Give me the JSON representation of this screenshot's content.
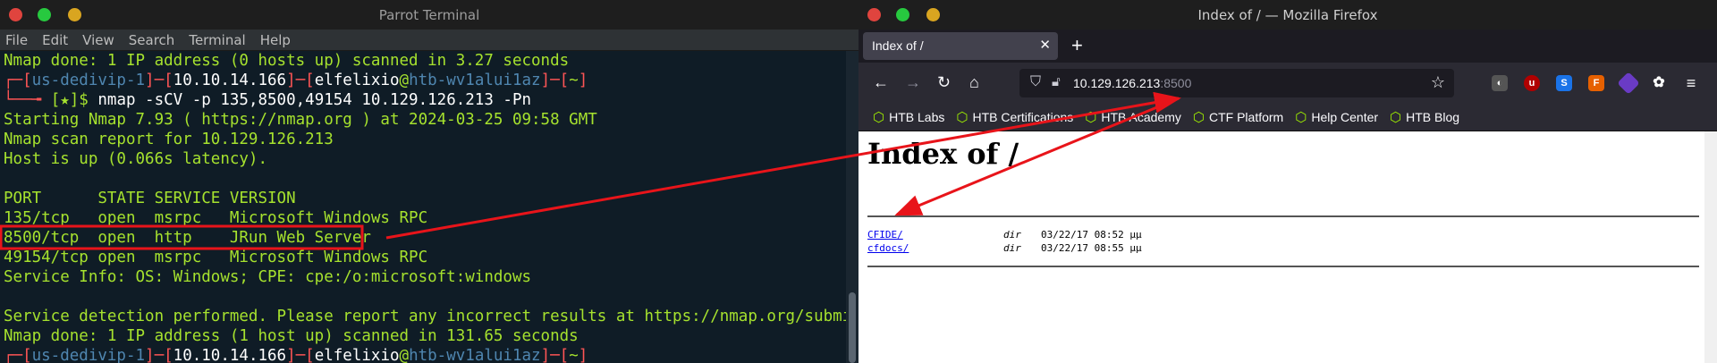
{
  "terminal": {
    "title": "Parrot Terminal",
    "menu": [
      "File",
      "Edit",
      "View",
      "Search",
      "Terminal",
      "Help"
    ],
    "lines": [
      {
        "parts": [
          {
            "t": "Nmap done: 1 IP address (0 hosts up) scanned in 3.27 seconds",
            "c": "c-g"
          }
        ]
      },
      {
        "parts": [
          {
            "t": "┌─[",
            "c": "c-red"
          },
          {
            "t": "us-dedivip-1",
            "c": "c-dim"
          },
          {
            "t": "]─[",
            "c": "c-red"
          },
          {
            "t": "10.10.14.166",
            "c": "c-white"
          },
          {
            "t": "]─[",
            "c": "c-red"
          },
          {
            "t": "elfelixio",
            "c": "c-white"
          },
          {
            "t": "@",
            "c": "c-g"
          },
          {
            "t": "htb-wv1alui1az",
            "c": "c-dim"
          },
          {
            "t": "]─[",
            "c": "c-red"
          },
          {
            "t": "~",
            "c": "c-g"
          },
          {
            "t": "]",
            "c": "c-red"
          }
        ]
      },
      {
        "parts": [
          {
            "t": "└──╼ ",
            "c": "c-red"
          },
          {
            "t": "[★]$ ",
            "c": "c-g"
          },
          {
            "t": "nmap -sCV -p 135,8500,49154 10.129.126.213 -Pn",
            "c": "c-white"
          }
        ]
      },
      {
        "parts": [
          {
            "t": "Starting Nmap 7.93 ( https://nmap.org ) at 2024-03-25 09:58 GMT",
            "c": "c-g"
          }
        ]
      },
      {
        "parts": [
          {
            "t": "Nmap scan report for 10.129.126.213",
            "c": "c-g"
          }
        ]
      },
      {
        "parts": [
          {
            "t": "Host is up (0.066s latency).",
            "c": "c-g"
          }
        ]
      },
      {
        "parts": [
          {
            "t": "",
            "c": "c-g"
          }
        ]
      },
      {
        "parts": [
          {
            "t": "PORT      STATE SERVICE VERSION",
            "c": "c-g"
          }
        ]
      },
      {
        "parts": [
          {
            "t": "135/tcp   open  msrpc   Microsoft Windows RPC",
            "c": "c-g"
          }
        ]
      },
      {
        "parts": [
          {
            "t": "8500/tcp  open  http    JRun Web Server",
            "c": "c-g"
          }
        ]
      },
      {
        "parts": [
          {
            "t": "49154/tcp open  msrpc   Microsoft Windows RPC",
            "c": "c-g"
          }
        ]
      },
      {
        "parts": [
          {
            "t": "Service Info: OS: Windows; CPE: cpe:/o:microsoft:windows",
            "c": "c-g"
          }
        ]
      },
      {
        "parts": [
          {
            "t": "",
            "c": "c-g"
          }
        ]
      },
      {
        "parts": [
          {
            "t": "Service detection performed. Please report any incorrect results at https://nmap.org/submit/ .",
            "c": "c-g"
          }
        ]
      },
      {
        "parts": [
          {
            "t": "Nmap done: 1 IP address (1 host up) scanned in 131.65 seconds",
            "c": "c-g"
          }
        ]
      },
      {
        "parts": [
          {
            "t": "┌─[",
            "c": "c-red"
          },
          {
            "t": "us-dedivip-1",
            "c": "c-dim"
          },
          {
            "t": "]─[",
            "c": "c-red"
          },
          {
            "t": "10.10.14.166",
            "c": "c-white"
          },
          {
            "t": "]─[",
            "c": "c-red"
          },
          {
            "t": "elfelixio",
            "c": "c-white"
          },
          {
            "t": "@",
            "c": "c-g"
          },
          {
            "t": "htb-wv1alui1az",
            "c": "c-dim"
          },
          {
            "t": "]─[",
            "c": "c-red"
          },
          {
            "t": "~",
            "c": "c-g"
          },
          {
            "t": "]",
            "c": "c-red"
          }
        ]
      }
    ]
  },
  "firefox": {
    "title": "Index of / — Mozilla Firefox",
    "tab_label": "Index of /",
    "url_host": "10.129.126.213",
    "url_port": ":8500",
    "bookmarks": [
      "HTB Labs",
      "HTB Certifications",
      "HTB Academy",
      "CTF Platform",
      "Help Center",
      "HTB Blog"
    ],
    "page": {
      "heading": "Index of /",
      "entries": [
        {
          "name": "CFIDE/",
          "type": "dir",
          "date": "03/22/17 08:52 μμ"
        },
        {
          "name": "cfdocs/",
          "type": "dir",
          "date": "03/22/17 08:55 μμ"
        }
      ]
    }
  },
  "colors": {
    "annotation": "#e8141a",
    "terminal_green": "#a6e22e",
    "htb_green": "#9fef00"
  }
}
